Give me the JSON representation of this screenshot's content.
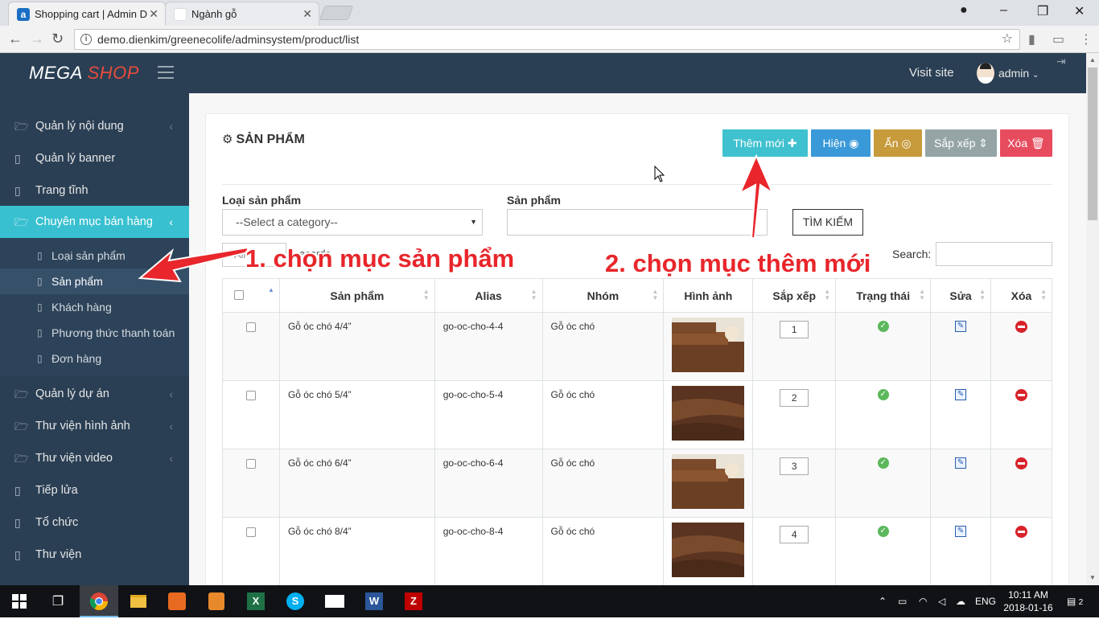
{
  "browser": {
    "tabs": [
      {
        "title": "Shopping cart | Admin D",
        "active": true
      },
      {
        "title": "Ngành gỗ",
        "active": false
      }
    ],
    "url": "demo.dienkim/greenecolife/adminsystem/product/list"
  },
  "header": {
    "logo_main": "MEGA ",
    "logo_accent": "SHOP",
    "visit_site": "Visit site",
    "user": "admin"
  },
  "sidebar": {
    "items": [
      {
        "label": "Quản lý nội dung"
      },
      {
        "label": "Quản lý banner"
      },
      {
        "label": "Trang tĩnh"
      },
      {
        "label": "Chuyên mục bán hàng"
      },
      {
        "label": "Quản lý dự án"
      },
      {
        "label": "Thư viện hình ảnh"
      },
      {
        "label": "Thư viện video"
      },
      {
        "label": "Tiếp lửa"
      },
      {
        "label": "Tổ chức"
      },
      {
        "label": "Thư viện"
      }
    ],
    "subitems": [
      {
        "label": "Loại sản phẩm"
      },
      {
        "label": "Sản phẩm"
      },
      {
        "label": "Khách hàng"
      },
      {
        "label": "Phương thức thanh toán"
      },
      {
        "label": "Đơn hàng"
      }
    ]
  },
  "page": {
    "title": "SẢN PHẨM",
    "buttons": {
      "add": "Thêm mới",
      "show": "Hiện",
      "hide": "Ẩn",
      "sort": "Sắp xếp",
      "delete": "Xóa"
    },
    "filters": {
      "category_label": "Loại sản phẩm",
      "category_value": "--Select a category--",
      "product_label": "Sản phẩm",
      "product_value": "",
      "search_button": "TÌM KIẾM"
    },
    "length_value": "All",
    "length_suffix": "ecords",
    "search_label": "Search:",
    "columns": [
      "Sản phẩm",
      "Alias",
      "Nhóm",
      "Hình ảnh",
      "Sắp xếp",
      "Trạng thái",
      "Sửa",
      "Xóa"
    ],
    "rows": [
      {
        "name": "Gỗ óc chó 4/4”",
        "alias": "go-oc-cho-4-4",
        "group": "Gỗ óc chó",
        "order": "1"
      },
      {
        "name": "Gỗ óc chó 5/4”",
        "alias": "go-oc-cho-5-4",
        "group": "Gỗ óc chó",
        "order": "2"
      },
      {
        "name": "Gỗ óc chó 6/4”",
        "alias": "go-oc-cho-6-4",
        "group": "Gỗ óc chó",
        "order": "3"
      },
      {
        "name": "Gỗ óc chó 8/4”",
        "alias": "go-oc-cho-8-4",
        "group": "Gỗ óc chó",
        "order": "4"
      }
    ]
  },
  "annotations": {
    "step1": "1. chọn mục sản phẩm",
    "step2": "2. chọn mục thêm mới"
  },
  "taskbar": {
    "lang": "ENG",
    "time": "10:11 AM",
    "date": "2018-01-16",
    "notifications": "2"
  }
}
